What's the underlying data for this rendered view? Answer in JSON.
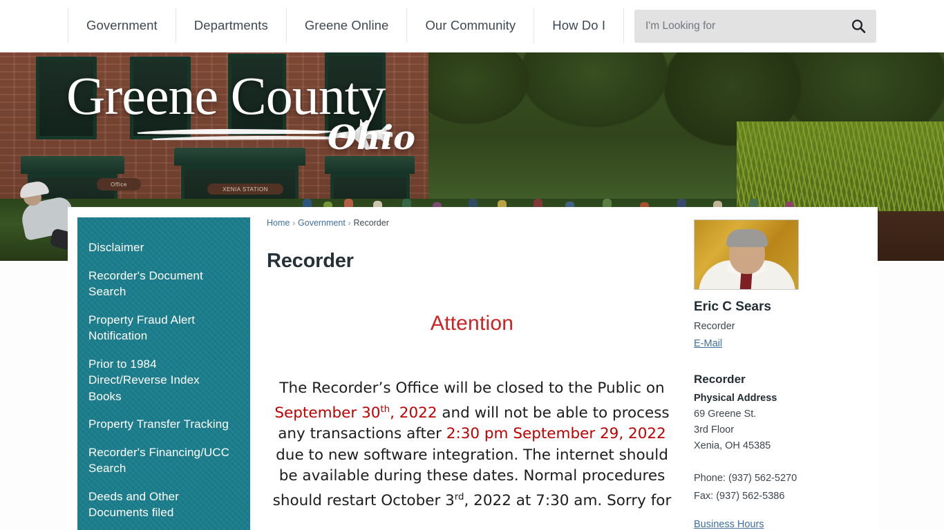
{
  "nav": {
    "items": [
      {
        "label": "Government"
      },
      {
        "label": "Departments"
      },
      {
        "label": "Greene Online"
      },
      {
        "label": "Our Community"
      },
      {
        "label": "How Do I"
      }
    ]
  },
  "search": {
    "placeholder": "I'm Looking for",
    "value": "",
    "icon": "search-icon"
  },
  "banner": {
    "logo_main": "Greene County",
    "logo_sub": "Ohio",
    "sign_office": "Office",
    "sign_station": "XENIA  STATION"
  },
  "sidebar": {
    "items": [
      {
        "label": "Disclaimer"
      },
      {
        "label": "Recorder's Document Search"
      },
      {
        "label": "Property Fraud Alert Notification"
      },
      {
        "label": "Prior to 1984 Direct/Reverse Index Books"
      },
      {
        "label": "Property Transfer Tracking"
      },
      {
        "label": "Recorder's Financing/UCC Search"
      },
      {
        "label": "Deeds and Other Documents filed"
      }
    ]
  },
  "breadcrumb": {
    "home": "Home",
    "government": "Government",
    "current": "Recorder",
    "separator": "›"
  },
  "main": {
    "page_title": "Recorder",
    "attention_heading": "Attention",
    "body": {
      "p1": "The Recorder’s Office will be closed to the Public on ",
      "date1": "September 30",
      "date1_sup": "th",
      "date1_rest": ", 2022",
      "p2": " and will not be able to process any transactions after ",
      "time1": "2:30 pm September 29, 2022",
      "p3": " due to new software integration. The internet should be available during these dates. Normal procedures should restart October 3",
      "p3_sup": "rd",
      "p4": ", 2022 at 7:30 am. Sorry for"
    }
  },
  "contact": {
    "photo_alt": "Eric C Sears portrait",
    "name": "Eric C Sears",
    "role": "Recorder",
    "email_label": "E-Mail",
    "department": "Recorder",
    "address_label": "Physical Address",
    "address_line1": "69 Greene St.",
    "address_line2": "3rd Floor",
    "address_line3": "Xenia, OH 45385",
    "phone": "Phone: (937) 562-5270",
    "fax": "Fax: (937) 562-5386",
    "business_hours_label": "Business Hours"
  },
  "colors": {
    "teal": "#1b7d8c",
    "link_blue": "#3f6fa0",
    "attention_red": "#cc2222",
    "highlight_red": "#c00000",
    "heading_dark": "#263238"
  }
}
